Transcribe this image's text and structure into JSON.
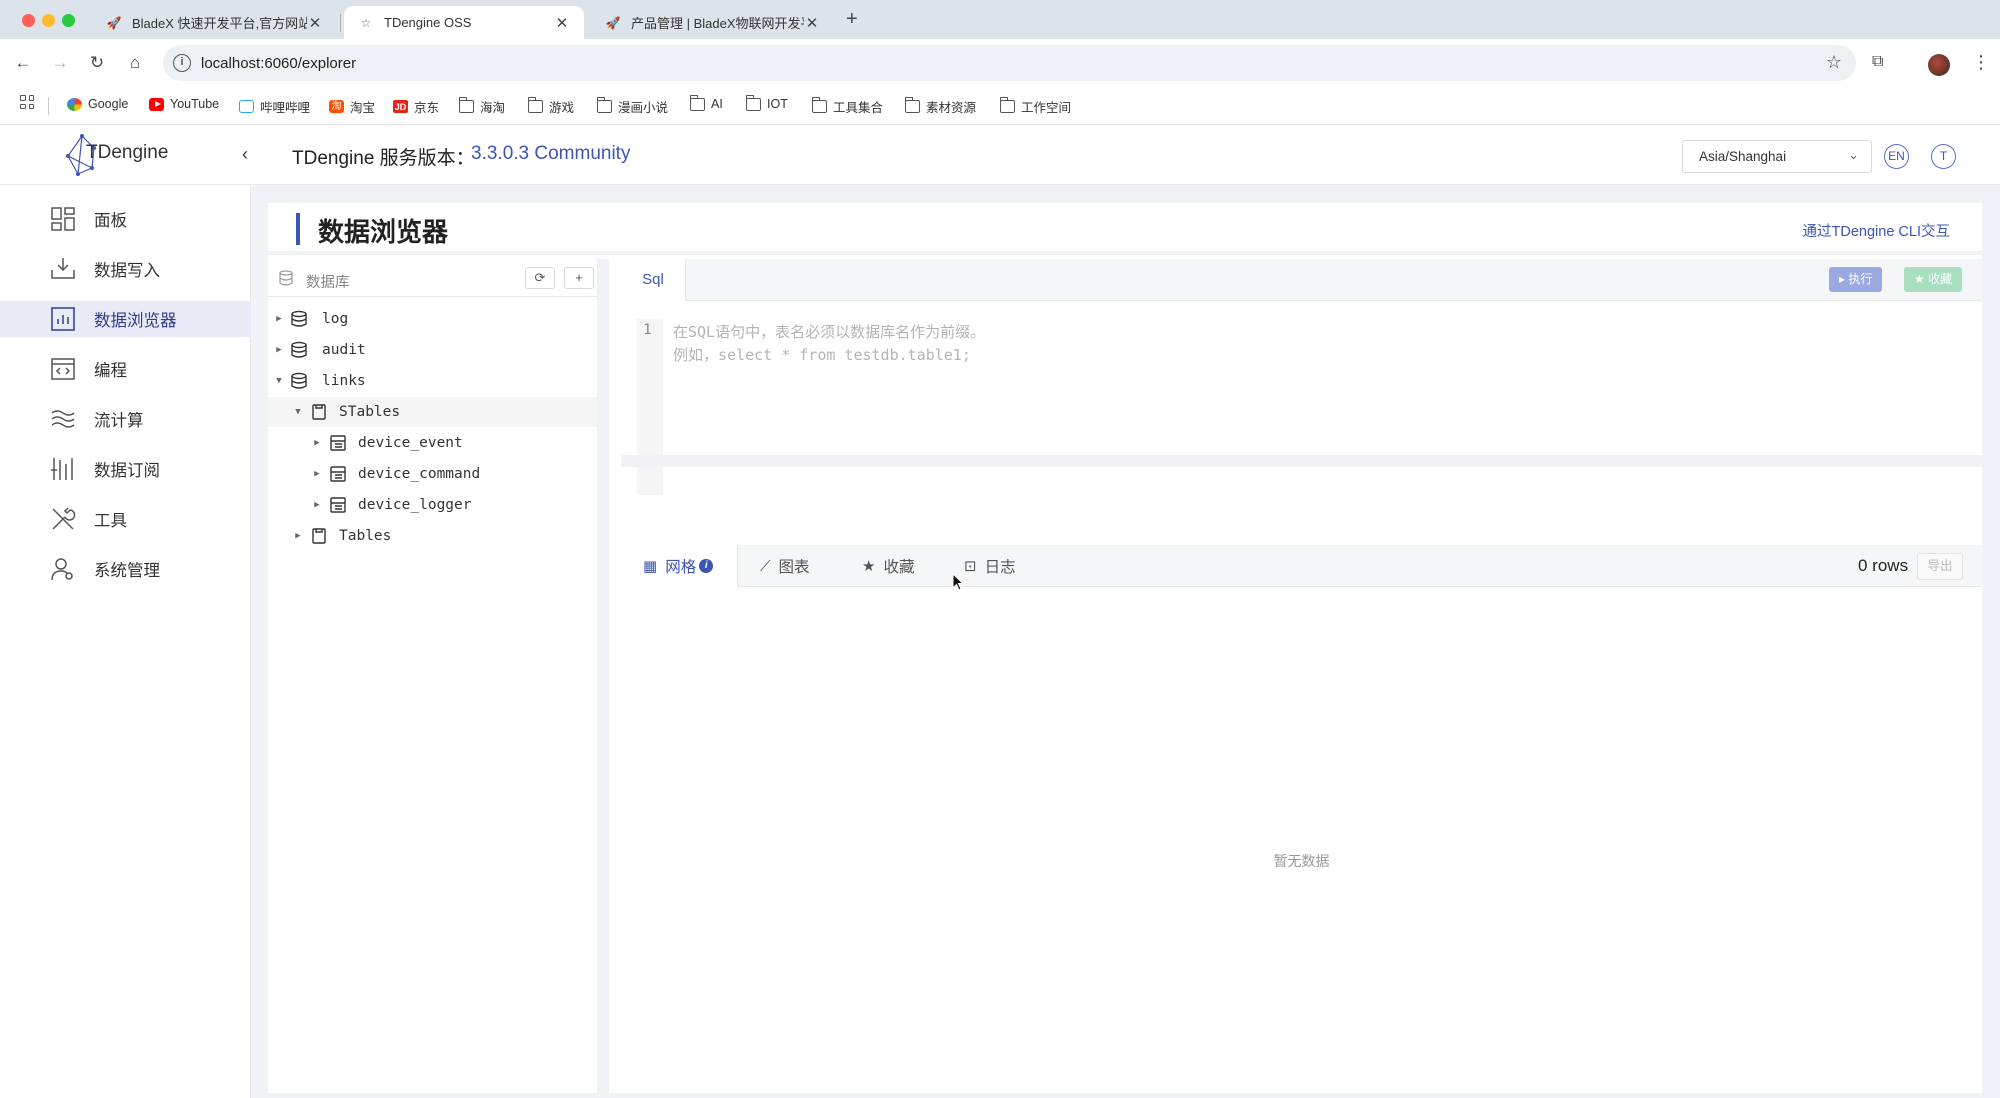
{
  "browser": {
    "tabs": [
      {
        "title": "BladeX 快速开发平台,官方网站",
        "active": false
      },
      {
        "title": "TDengine OSS",
        "active": true
      },
      {
        "title": "产品管理 | BladeX物联网开发平",
        "active": false
      }
    ],
    "url": "localhost:6060/explorer",
    "bookmarks": [
      "Google",
      "YouTube",
      "哔哩哔哩",
      "淘宝",
      "京东",
      "海淘",
      "游戏",
      "漫画小说",
      "AI",
      "IOT",
      "工具集合",
      "素材资源",
      "工作空间"
    ]
  },
  "app": {
    "logo_text": "TDengine",
    "service_label": "TDengine 服务版本：",
    "service_version": "3.3.0.3 Community",
    "timezone": "Asia/Shanghai",
    "lang_button": "EN",
    "user_button": "T",
    "accent_color": "#3d55b5"
  },
  "sidebar": {
    "items": [
      {
        "label": "面板",
        "icon": "dashboard-icon",
        "active": false
      },
      {
        "label": "数据写入",
        "icon": "data-in-icon",
        "active": false
      },
      {
        "label": "数据浏览器",
        "icon": "explorer-icon",
        "active": true
      },
      {
        "label": "编程",
        "icon": "code-icon",
        "active": false
      },
      {
        "label": "流计算",
        "icon": "stream-icon",
        "active": false
      },
      {
        "label": "数据订阅",
        "icon": "subscribe-icon",
        "active": false
      },
      {
        "label": "工具",
        "icon": "tools-icon",
        "active": false
      },
      {
        "label": "系统管理",
        "icon": "admin-icon",
        "active": false
      }
    ]
  },
  "page": {
    "title": "数据浏览器",
    "cli_link": "通过TDengine CLI交互"
  },
  "db_panel": {
    "title": "数据库",
    "tree": [
      {
        "label": "log",
        "level": 0,
        "expanded": false
      },
      {
        "label": "audit",
        "level": 0,
        "expanded": false
      },
      {
        "label": "links",
        "level": 0,
        "expanded": true
      },
      {
        "label": "STables",
        "level": 1,
        "expanded": true
      },
      {
        "label": "device_event",
        "level": 2,
        "expanded": false
      },
      {
        "label": "device_command",
        "level": 2,
        "expanded": false
      },
      {
        "label": "device_logger",
        "level": 2,
        "expanded": false
      },
      {
        "label": "Tables",
        "level": 1,
        "expanded": false
      }
    ]
  },
  "editor": {
    "tab": "Sql",
    "run_label": "执行",
    "fav_label": "收藏",
    "line_number": "1",
    "placeholder_lines": [
      "在SQL语句中，表名必须以数据库名作为前缀。",
      "例如，select * from testdb.table1;"
    ]
  },
  "results": {
    "tabs": [
      {
        "label": "网格",
        "icon": "grid-icon",
        "active": true
      },
      {
        "label": "图表",
        "icon": "chart-icon",
        "active": false
      },
      {
        "label": "收藏",
        "icon": "star-icon",
        "active": false
      },
      {
        "label": "日志",
        "icon": "terminal-icon",
        "active": false
      }
    ],
    "rows_count": "0 rows",
    "export_label": "导出",
    "empty_text": "暂无数据"
  }
}
